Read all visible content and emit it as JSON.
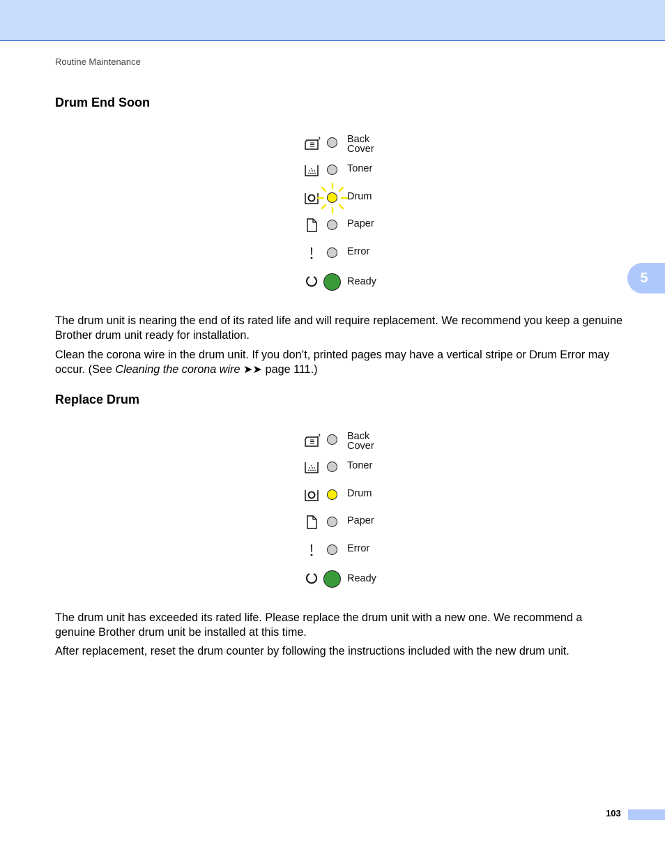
{
  "header": {
    "running_head": "Routine Maintenance",
    "band_color": "#cadcfc",
    "rule_color": "#1a4fd0"
  },
  "chapter_tab": {
    "label": "5",
    "color": "#aec8fb"
  },
  "sections": [
    {
      "title": "Drum End Soon",
      "leds": [
        {
          "icon": "back-cover-icon",
          "label_line1": "Back",
          "label_line2": "Cover",
          "state": "off"
        },
        {
          "icon": "toner-icon",
          "label_line1": "Toner",
          "state": "off"
        },
        {
          "icon": "drum-icon",
          "label_line1": "Drum",
          "state": "blinking-yellow"
        },
        {
          "icon": "paper-icon",
          "label_line1": "Paper",
          "state": "off"
        },
        {
          "icon": "error-icon",
          "label_line1": "Error",
          "state": "off"
        },
        {
          "icon": "ready-icon",
          "label_line1": "Ready",
          "state": "on-green"
        }
      ],
      "paragraphs": [
        "The drum unit is nearing the end of its rated life and will require replacement. We recommend you keep a genuine Brother drum unit ready for installation."
      ],
      "note": {
        "prefix": "Clean the corona wire in the drum unit. If you don’t, printed pages may have a vertical stripe or Drum Error may occur. (See ",
        "link_italic": "Cleaning the corona wire",
        "arrows": " ➤➤ ",
        "suffix": "page 111.)"
      }
    },
    {
      "title": "Replace Drum",
      "leds": [
        {
          "icon": "back-cover-icon",
          "label_line1": "Back",
          "label_line2": "Cover",
          "state": "off"
        },
        {
          "icon": "toner-icon",
          "label_line1": "Toner",
          "state": "off"
        },
        {
          "icon": "drum-icon",
          "label_line1": "Drum",
          "state": "on-yellow"
        },
        {
          "icon": "paper-icon",
          "label_line1": "Paper",
          "state": "off"
        },
        {
          "icon": "error-icon",
          "label_line1": "Error",
          "state": "off"
        },
        {
          "icon": "ready-icon",
          "label_line1": "Ready",
          "state": "on-green"
        }
      ],
      "paragraphs": [
        "The drum unit has exceeded its rated life. Please replace the drum unit with a new one. We recommend a genuine Brother drum unit be installed at this time.",
        "After replacement, reset the drum counter by following the instructions included with the new drum unit."
      ]
    }
  ],
  "footer": {
    "page_number": "103",
    "bar_color": "#b3cbfb"
  }
}
